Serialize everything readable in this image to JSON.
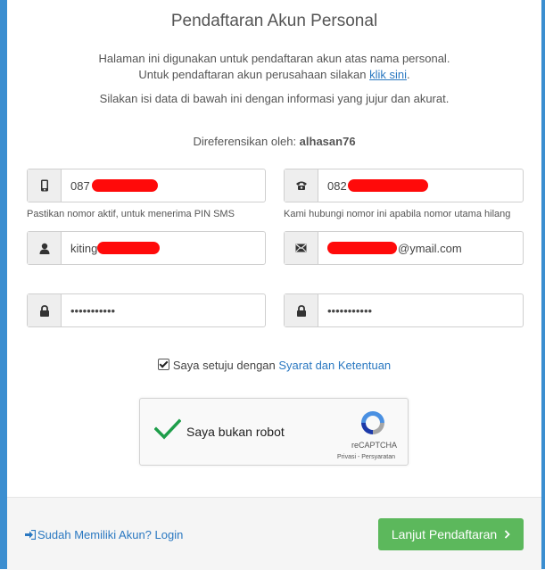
{
  "page": {
    "title": "Pendaftaran Akun Personal",
    "intro_line1": "Halaman ini digunakan untuk pendaftaran akun atas nama personal.",
    "intro_line2_prefix": "Untuk pendaftaran akun perusahaan silakan ",
    "intro_link": "klik sini",
    "intro_line2_suffix": ".",
    "intro_line3": "Silakan isi data di bawah ini dengan informasi yang jujur dan akurat.",
    "referral_label": "Direferensikan oleh: ",
    "referral_value": "alhasan76"
  },
  "form": {
    "phone_primary": {
      "value": "087",
      "help": "Pastikan nomor aktif, untuk menerima PIN SMS",
      "icon": "mobile-icon"
    },
    "phone_backup": {
      "value": "082",
      "help": "Kami hubungi nomor ini apabila nomor utama hilang",
      "icon": "phone-icon"
    },
    "username": {
      "value": "kiting",
      "icon": "user-icon"
    },
    "email": {
      "suffix": "@ymail.com",
      "icon": "envelope-icon"
    },
    "password": {
      "value": "•••••••••••",
      "icon": "lock-icon"
    },
    "password_confirm": {
      "value": "•••••••••••",
      "icon": "lock-icon"
    }
  },
  "agreement": {
    "prefix": "Saya setuju dengan ",
    "link": "Syarat dan Ketentuan",
    "checked": true
  },
  "captcha": {
    "label": "Saya bukan robot",
    "brand": "reCAPTCHA",
    "legal": "Privasi - Persyaratan"
  },
  "footer": {
    "login_link": "Sudah Memiliki Akun? Login",
    "next_button": "Lanjut Pendaftaran"
  },
  "colors": {
    "accent_blue": "#3b8ed0",
    "link": "#2a78c1",
    "success_green": "#5cb85c",
    "redaction_red": "#ff0a0a"
  }
}
